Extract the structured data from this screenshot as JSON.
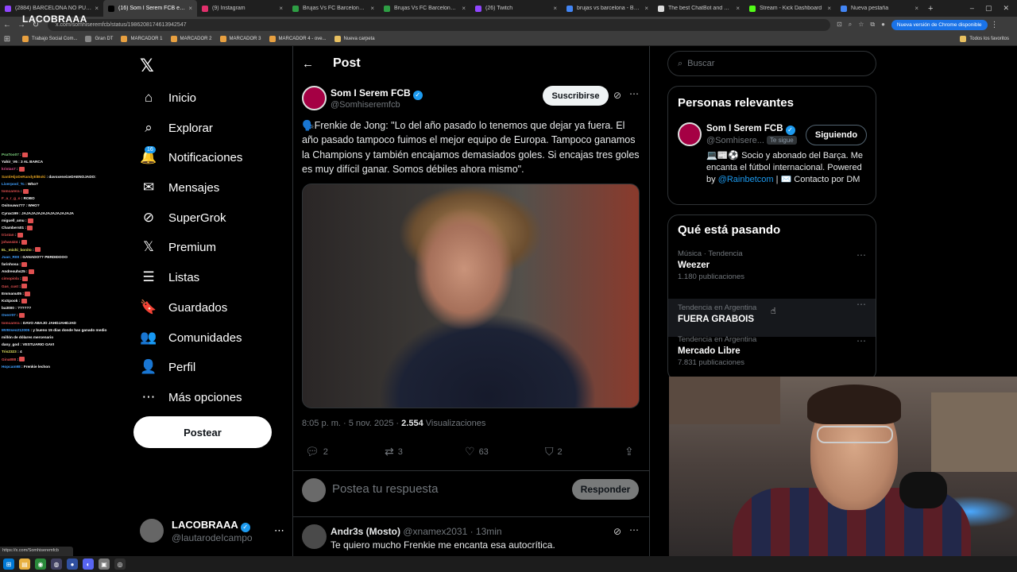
{
  "browser": {
    "tabs": [
      {
        "title": "(2884) BARCELONA NO PUDO",
        "color": "#9146ff",
        "active": false
      },
      {
        "title": "(16) Som I Serem FCB en X: \"",
        "color": "#000000",
        "active": true
      },
      {
        "title": "(9) Instagram",
        "color": "#e1306c",
        "active": false
      },
      {
        "title": "Brujas Vs FC Barcelona - Resu",
        "color": "#2e9e44",
        "active": false
      },
      {
        "title": "Brujas Vs FC Barcelona - Resu",
        "color": "#2e9e44",
        "active": false
      },
      {
        "title": "(26) Twitch",
        "color": "#9146ff",
        "active": false
      },
      {
        "title": "brujas vs barcelona - Buscar c",
        "color": "#4285f4",
        "active": false
      },
      {
        "title": "The best ChatBot and Widget",
        "color": "#dddddd",
        "active": false
      },
      {
        "title": "Stream - Kick Dashboard",
        "color": "#53fc18",
        "active": false
      },
      {
        "title": "Nueva pestaña",
        "color": "#4285f4",
        "active": false
      }
    ],
    "url": "x.com/somhiseremfcb/status/1986208174613942547",
    "update_label": "Nueva versión de Chrome disponible",
    "bookmarks": [
      {
        "label": "Trabajo Social Com...",
        "color": "#e8a040"
      },
      {
        "label": "Gran DT",
        "color": "#888888"
      },
      {
        "label": "MARCADOR 1",
        "color": "#e8a040"
      },
      {
        "label": "MARCADOR 2",
        "color": "#e8a040"
      },
      {
        "label": "MARCADOR 3",
        "color": "#e8a040"
      },
      {
        "label": "MARCADOR 4 - ove...",
        "color": "#e8a040"
      },
      {
        "label": "Nueva carpeta",
        "color": "#e8c060"
      }
    ],
    "bookmarks_all": "Todos los favoritos",
    "status_url": "https://x.com/Somhiseremfcb"
  },
  "overlay": {
    "logo": "LACOBRAAA",
    "chat": [
      {
        "user": "PsaToo07",
        "msg": "",
        "emote": true,
        "color": "#7fd37f"
      },
      {
        "user": "Yahir_V6",
        "msg": "3 AL BARCA",
        "emote": false,
        "color": "#ffffff"
      },
      {
        "user": "kristas7",
        "msg": "",
        "emote": true,
        "color": "#e05090"
      },
      {
        "user": "SantiHijoDeRandyElBoki",
        "msg": "davoxeneizeDAENOJADO:",
        "emote": false,
        "color": "#e0a020"
      },
      {
        "user": "Liverpool_Tc",
        "msg": "Who?",
        "emote": false,
        "color": "#40a0ff"
      },
      {
        "user": "tomcarera",
        "msg": "",
        "emote": true,
        "color": "#e05050"
      },
      {
        "user": "F_a_r_g_o",
        "msg": "ROBO",
        "emote": false,
        "color": "#e05050"
      },
      {
        "user": "Ositouwu777",
        "msg": "WHO?",
        "emote": false,
        "color": "#ffffff"
      },
      {
        "user": "Cyrax199",
        "msg": "JAJAJAJAJAJAJAJAJAJAJA",
        "emote": false,
        "color": "#ffffff"
      },
      {
        "user": "miguell_amu",
        "msg": "",
        "emote": true,
        "color": "#ffffff"
      },
      {
        "user": "Chambers01",
        "msg": "",
        "emote": true,
        "color": "#ffffff"
      },
      {
        "user": "tr1stan",
        "msg": "",
        "emote": true,
        "color": "#e05050"
      },
      {
        "user": "johan424",
        "msg": "",
        "emote": true,
        "color": "#e05050"
      },
      {
        "user": "EL_michi_bonito",
        "msg": "",
        "emote": true,
        "color": "#e0e060"
      },
      {
        "user": "Juan_R00",
        "msg": "GANADO?? PERDIDOOO",
        "emote": false,
        "color": "#40a0ff"
      },
      {
        "user": "farinhosa",
        "msg": "",
        "emote": true,
        "color": "#ffffff"
      },
      {
        "user": "Andresuhs25",
        "msg": "",
        "emote": true,
        "color": "#ffffff"
      },
      {
        "user": "cimopiola",
        "msg": "",
        "emote": true,
        "color": "#e05050"
      },
      {
        "user": "Gas_cust",
        "msg": "",
        "emote": true,
        "color": "#e05050"
      },
      {
        "user": "Emmanu05",
        "msg": "",
        "emote": true,
        "color": "#ffffff"
      },
      {
        "user": "KxSpook",
        "msg": "",
        "emote": true,
        "color": "#ffffff"
      },
      {
        "user": "ba3000",
        "msg": "??????",
        "emote": false,
        "color": "#ffffff"
      },
      {
        "user": "Overr07",
        "msg": "",
        "emote": true,
        "color": "#40a0ff"
      },
      {
        "user": "tomcarera",
        "msg": "DAVO ABAJO JAHDJAHDJAD",
        "emote": false,
        "color": "#e05050"
      },
      {
        "user": "MVEIseo212005",
        "msg": "y bueno 15 días donde has ganado medio",
        "emote": false,
        "color": "#40a0ff"
      },
      {
        "user": "",
        "msg": "millón de dólares mercenario",
        "emote": false,
        "color": "#ffffff"
      },
      {
        "user": "dany_god",
        "msg": "VESTUARIO GAVI",
        "emote": false,
        "color": "#ffffff"
      },
      {
        "user": "Tris2323",
        "msg": "4",
        "emote": false,
        "color": "#e0e060"
      },
      {
        "user": "Gina888",
        "msg": "",
        "emote": true,
        "color": "#e05050"
      },
      {
        "user": "Hopcam98",
        "msg": "Frenkie lechon",
        "emote": false,
        "color": "#40a0ff"
      }
    ]
  },
  "nav": {
    "items": [
      {
        "label": "Inicio",
        "icon": "home-icon",
        "glyph": "⌂"
      },
      {
        "label": "Explorar",
        "icon": "search-icon",
        "glyph": "⌕"
      },
      {
        "label": "Notificaciones",
        "icon": "bell-icon",
        "glyph": "🔔"
      },
      {
        "label": "Mensajes",
        "icon": "mail-icon",
        "glyph": "✉"
      },
      {
        "label": "SuperGrok",
        "icon": "grok-icon",
        "glyph": "⊘"
      },
      {
        "label": "Premium",
        "icon": "x-premium-icon",
        "glyph": "𝕏"
      },
      {
        "label": "Listas",
        "icon": "list-icon",
        "glyph": "☰"
      },
      {
        "label": "Guardados",
        "icon": "bookmark-icon",
        "glyph": "🔖"
      },
      {
        "label": "Comunidades",
        "icon": "communities-icon",
        "glyph": "👥"
      },
      {
        "label": "Perfil",
        "icon": "profile-icon",
        "glyph": "👤"
      },
      {
        "label": "Más opciones",
        "icon": "more-options-icon",
        "glyph": "⋯"
      }
    ],
    "notif_badge": "16",
    "post_button": "Postear",
    "account_name": "LACOBRAAA",
    "account_handle": "@lautarodeIcampo"
  },
  "post": {
    "header": "Post",
    "author_name": "Som I Serem FCB",
    "author_handle": "@Somhiseremfcb",
    "subscribe": "Suscribirse",
    "text": "🗣️Frenkie de Jong: \"Lo del año pasado lo tenemos que dejar ya fuera. El año pasado tampoco fuimos el mejor equipo de Europa. Tampoco ganamos la Champions y también encajamos demasiados goles. Si encajas tres goles es muy difícil ganar. Somos débiles ahora mismo\".",
    "timestamp": "8:05 p. m. · 5 nov. 2025 · ",
    "views_count": "2.554",
    "views_label": " Visualizaciones",
    "replies": "2",
    "reposts": "3",
    "likes": "63",
    "bookmarks": "2",
    "reply_placeholder": "Postea tu respuesta",
    "reply_button": "Responder"
  },
  "comment": {
    "name": "Andr3s (Mosto)",
    "handle": "@xnamex2031",
    "time": "· 13min",
    "text": "Te quiero mucho Frenkie me encanta esa autocrítica."
  },
  "sidebar": {
    "search_placeholder": "Buscar",
    "relevant_title": "Personas relevantes",
    "relevant": {
      "name": "Som I Serem FCB",
      "handle": "@Somhisere...",
      "follows_you": "Te sigue",
      "button": "Siguiendo",
      "bio_1": "💻📰⚽ Socio y abonado del Barça. Me encanta el fútbol internacional. Powered by ",
      "bio_link": "@Rainbetcom",
      "bio_2": " | ✉️ Contacto por DM"
    },
    "trends_title": "Qué está pasando",
    "trends": [
      {
        "context": "Música · Tendencia",
        "name": "Weezer",
        "posts": "1.180 publicaciones"
      },
      {
        "context": "Tendencia en Argentina",
        "name": "FUERA GRABOIS",
        "posts": ""
      },
      {
        "context": "Tendencia en Argentina",
        "name": "Mercado Libre",
        "posts": "7.831 publicaciones"
      }
    ]
  }
}
